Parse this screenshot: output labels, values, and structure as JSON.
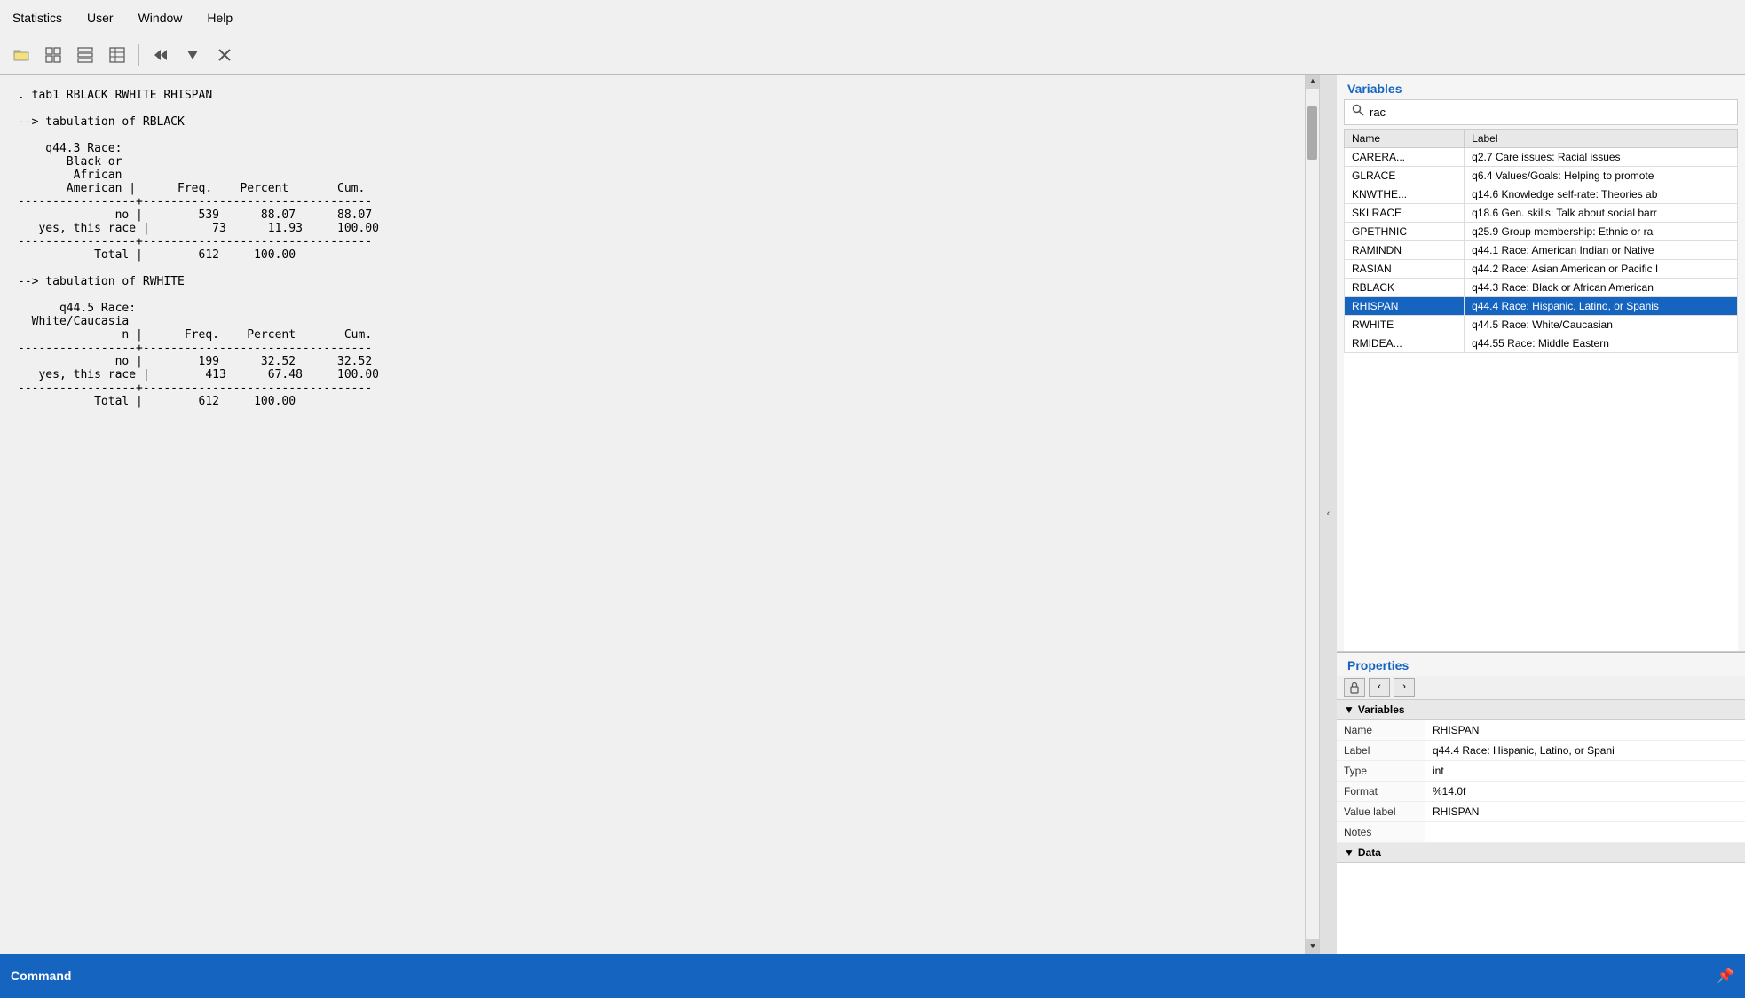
{
  "menubar": {
    "items": [
      "Statistics",
      "User",
      "Window",
      "Help"
    ]
  },
  "toolbar": {
    "buttons": [
      {
        "name": "open-data-icon",
        "symbol": "📂"
      },
      {
        "name": "grid-icon",
        "symbol": "⊞"
      },
      {
        "name": "grid2-icon",
        "symbol": "⊟"
      },
      {
        "name": "report-icon",
        "symbol": "▤"
      },
      {
        "name": "back-icon",
        "symbol": "▽"
      },
      {
        "name": "dropdown-icon",
        "symbol": "▾"
      },
      {
        "name": "close-icon",
        "symbol": "✕"
      }
    ]
  },
  "results": {
    "command_line": ". tab1 RBLACK RWHITE RHISPAN",
    "tabulations": [
      {
        "header": "--> tabulation of RBLACK",
        "row_label": "q44.3 Race:\nBlack or\nAfrican\nAmerican",
        "col_headers": [
          "Freq.",
          "Percent",
          "Cum."
        ],
        "rows": [
          {
            "label": "no",
            "freq": "539",
            "percent": "88.07",
            "cum": "88.07"
          },
          {
            "label": "yes, this race",
            "freq": "73",
            "percent": "11.93",
            "cum": "100.00"
          }
        ],
        "total": {
          "label": "Total",
          "freq": "612",
          "percent": "100.00",
          "cum": ""
        }
      },
      {
        "header": "--> tabulation of RWHITE",
        "row_label": "q44.5 Race:\nWhite/Caucasia\nn",
        "col_headers": [
          "Freq.",
          "Percent",
          "Cum."
        ],
        "rows": [
          {
            "label": "no",
            "freq": "199",
            "percent": "32.52",
            "cum": "32.52"
          },
          {
            "label": "yes, this race",
            "freq": "413",
            "percent": "67.48",
            "cum": "100.00"
          }
        ],
        "total": {
          "label": "Total",
          "freq": "612",
          "percent": "100.00",
          "cum": ""
        }
      }
    ]
  },
  "variables_panel": {
    "title": "Variables",
    "search_value": "rac",
    "search_placeholder": "rac",
    "columns": [
      "Name",
      "Label"
    ],
    "rows": [
      {
        "name": "CARERA...",
        "label": "q2.7 Care issues: Racial issues",
        "selected": false
      },
      {
        "name": "GLRACE",
        "label": "q6.4 Values/Goals: Helping to promote",
        "selected": false
      },
      {
        "name": "KNWTHE...",
        "label": "q14.6 Knowledge self-rate: Theories ab",
        "selected": false
      },
      {
        "name": "SKLRACE",
        "label": "q18.6 Gen. skills: Talk about social barr",
        "selected": false
      },
      {
        "name": "GPETHNIC",
        "label": "q25.9 Group membership: Ethnic or ra",
        "selected": false
      },
      {
        "name": "RAMINDN",
        "label": "q44.1 Race: American Indian or Native",
        "selected": false
      },
      {
        "name": "RASIAN",
        "label": "q44.2 Race: Asian American or Pacific I",
        "selected": false
      },
      {
        "name": "RBLACK",
        "label": "q44.3 Race: Black or African American",
        "selected": false
      },
      {
        "name": "RHISPAN",
        "label": "q44.4 Race: Hispanic, Latino, or Spanis",
        "selected": true
      },
      {
        "name": "RWHITE",
        "label": "q44.5 Race: White/Caucasian",
        "selected": false
      },
      {
        "name": "RMIDEA...",
        "label": "q44.55 Race: Middle Eastern",
        "selected": false
      }
    ]
  },
  "properties_panel": {
    "title": "Properties",
    "variables_section": {
      "label": "Variables",
      "rows": [
        {
          "key": "Name",
          "value": "RHISPAN"
        },
        {
          "key": "Label",
          "value": "q44.4 Race: Hispanic, Latino, or Spani"
        },
        {
          "key": "Type",
          "value": "int"
        },
        {
          "key": "Format",
          "value": "%14.0f"
        },
        {
          "key": "Value label",
          "value": "RHISPAN"
        },
        {
          "key": "Notes",
          "value": ""
        }
      ]
    },
    "data_section": {
      "label": "Data"
    }
  },
  "command_bar": {
    "label": "Command",
    "pin_symbol": "📌"
  }
}
